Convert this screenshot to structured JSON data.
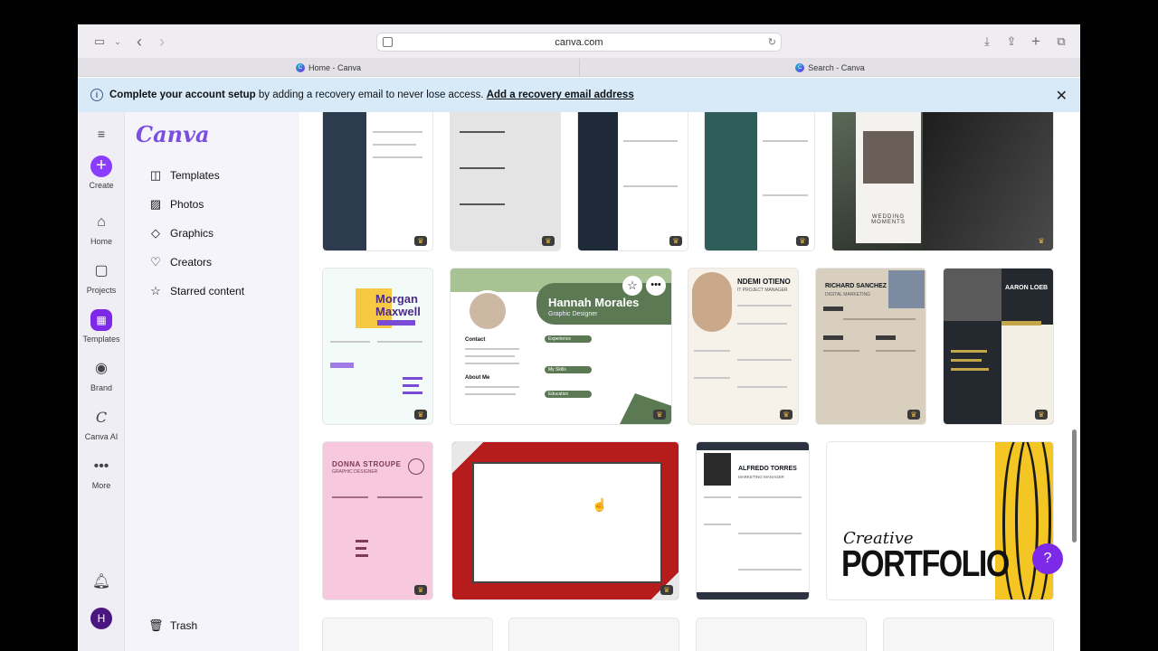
{
  "browser": {
    "url": "canva.com",
    "tabs": [
      "Home - Canva",
      "Search - Canva"
    ]
  },
  "banner": {
    "bold": "Complete your account setup",
    "rest": " by adding a recovery email to never lose access. ",
    "link": "Add a recovery email address"
  },
  "rail": {
    "create": "Create",
    "home": "Home",
    "projects": "Projects",
    "templates": "Templates",
    "brand": "Brand",
    "ai": "Canva AI",
    "more": "More",
    "avatar": "H"
  },
  "sidebar": {
    "logo": "Canva",
    "items": [
      "Templates",
      "Photos",
      "Graphics",
      "Creators",
      "Starred content"
    ],
    "trash": "Trash"
  },
  "cards": {
    "morgan_first": "Morgan",
    "morgan_last": "Maxwell",
    "hannah": "Hannah Morales",
    "hannah_role": "Graphic Designer",
    "hannah_exp": "Experience",
    "hannah_skills": "My Skills",
    "hannah_edu": "Education",
    "hannah_contact": "Contact",
    "hannah_about": "About Me",
    "ndemi": "NDEMI OTIENO",
    "ndemi_role": "IT PROJECT MANAGER",
    "richard": "RICHARD SANCHEZ",
    "richard_role": "DIGITAL MARKETING",
    "aaron": "AARON LOEB",
    "donna": "DONNA STROUPE",
    "donna_role": "GRAPHIC DESIGNER",
    "alfredo": "ALFREDO TORRES",
    "alfredo_role": "MARKETING MANAGER",
    "wedding": "WEDDING MOMENTS",
    "portfolio_script": "Creative",
    "portfolio_big": "PORTFOLIO"
  },
  "colors": {
    "accent": "#7d2ae8",
    "banner": "#d8eaf7"
  }
}
